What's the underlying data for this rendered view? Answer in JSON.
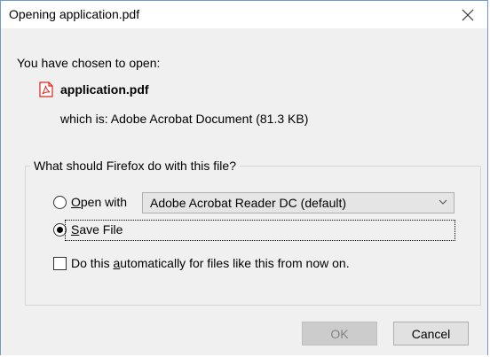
{
  "dialog": {
    "title": "Opening application.pdf"
  },
  "intro": {
    "chosen_text": "You have chosen to open:",
    "filename": "application.pdf",
    "which_is_text": "which is:  Adobe Acrobat Document (81.3 KB)"
  },
  "action_group": {
    "legend": "What should Firefox do with this file?",
    "open_with": {
      "label_prefix": "",
      "label_mnemonic": "O",
      "label_rest": "pen with",
      "selected": false
    },
    "app_select": {
      "value": "Adobe Acrobat Reader DC  (default)"
    },
    "save_file": {
      "label_mnemonic": "S",
      "label_rest": "ave File",
      "selected": true
    },
    "auto_checkbox": {
      "label_prefix": "Do this ",
      "label_mnemonic": "a",
      "label_rest": "utomatically for files like this from now on.",
      "checked": false
    }
  },
  "buttons": {
    "ok": "OK",
    "cancel": "Cancel"
  },
  "icons": {
    "close": "close-icon",
    "pdf": "pdf-file-icon",
    "dropdown": "chevron-down-icon"
  },
  "colors": {
    "title_border": "#6b9bd1",
    "pdf_red": "#e2231a",
    "dialog_bg": "#f0f0f0"
  }
}
